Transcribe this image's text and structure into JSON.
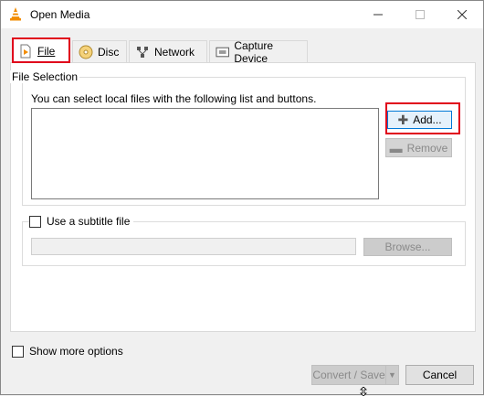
{
  "window": {
    "title": "Open Media",
    "icon": "vlc-cone-icon",
    "controls": [
      "minimize-icon",
      "maximize-icon",
      "close-icon"
    ]
  },
  "tabs": [
    {
      "label": "File",
      "icon": "file-icon",
      "selected": true
    },
    {
      "label": "Disc",
      "icon": "disc-icon",
      "selected": false
    },
    {
      "label": "Network",
      "icon": "network-icon",
      "selected": false
    },
    {
      "label": "Capture Device",
      "icon": "capture-device-icon",
      "selected": false
    }
  ],
  "file_selection": {
    "title": "File Selection",
    "description": "You can select local files with the following list and buttons.",
    "add_label": "Add...",
    "remove_label": "Remove"
  },
  "subtitle": {
    "checkbox_label": "Use a subtitle file",
    "checked": false,
    "input_value": "",
    "browse_label": "Browse..."
  },
  "footer": {
    "show_more_label": "Show more options",
    "show_more_checked": false,
    "convert_label": "Convert / Save",
    "cancel_label": "Cancel"
  },
  "colors": {
    "highlight": "#e0001b",
    "focus": "#0078d7"
  }
}
